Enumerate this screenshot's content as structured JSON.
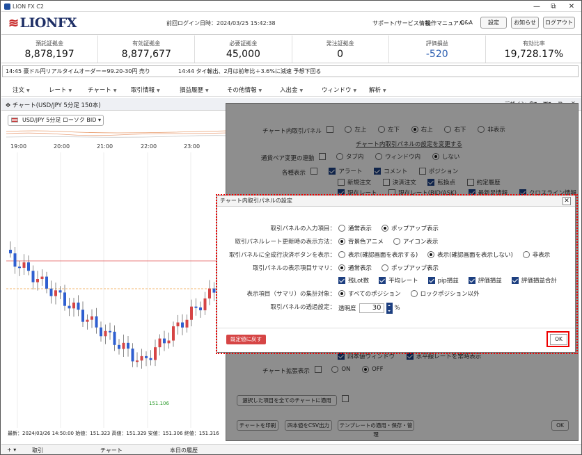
{
  "window": {
    "title": "LION FX C2",
    "controls": [
      "—",
      "⧉",
      "✕"
    ]
  },
  "header": {
    "logo": "LIONFX",
    "last_login": "前回ログイン日時：2024/03/25 15:42:38",
    "links": [
      "サポート/サービス情報",
      "操作マニュアル",
      "Q&A"
    ],
    "buttons": [
      "設定",
      "お知らせ",
      "ログアウト"
    ]
  },
  "summary": [
    {
      "label": "預託証拠金",
      "value": "8,878,197"
    },
    {
      "label": "有効証拠金",
      "value": "8,877,677"
    },
    {
      "label": "必要証拠金",
      "value": "45,000"
    },
    {
      "label": "発注証拠金",
      "value": "0"
    },
    {
      "label": "評価損益",
      "value": "-520"
    },
    {
      "label": "有効比率",
      "value": "19,728.17%"
    }
  ],
  "ticker": "14:45  豪ドル円リアルタイムオーダー＝99.20-30円  売り　　　　　14:44  タイ輸出、2月は前年比＋3.6%に減速  予想下回る",
  "menu": [
    "注文",
    "レート",
    "チャート",
    "取引情報",
    "損益履歴",
    "その他情報",
    "入出金",
    "ウィンドウ",
    "解析"
  ],
  "chart": {
    "title": "チャート(USD/JPY 5分足 150本)",
    "pair_select": "USD/JPY 5分足 ローソク BID",
    "time_labels": [
      "19:00",
      "20:00",
      "21:00",
      "22:00",
      "23:00"
    ],
    "low_label": "151.106",
    "info": "最新：2024/03/26 14:50:00  始値：151.323  高値：151.329  安値：151.306  終値：151.316",
    "design_label": "デザイン"
  },
  "bottom_tabs": [
    "取引",
    "チャート",
    "本日の履歴"
  ],
  "panel": {
    "trade_panel_label": "チャート内取引パネル",
    "trade_panel_options": [
      "左上",
      "左下",
      "右上",
      "右下",
      "非表示"
    ],
    "trade_panel_selected": 2,
    "trade_panel_link": "チャート内取引パネルの設定を変更する",
    "pair_change_label": "通貨ペア変更の連動",
    "pair_change_options": [
      "タブ内",
      "ウィンドウ内",
      "しない"
    ],
    "pair_change_selected": 2,
    "display_label": "各種表示",
    "display_items": [
      {
        "label": "アラート",
        "on": true
      },
      {
        "label": "コメント",
        "on": true
      },
      {
        "label": "ポジション",
        "on": false
      },
      {
        "label": "新規注文",
        "on": false
      },
      {
        "label": "決済注文",
        "on": false
      },
      {
        "label": "転換点",
        "on": true
      },
      {
        "label": "約定履歴",
        "on": false
      },
      {
        "label": "現在レート",
        "on": true
      },
      {
        "label": "現在レート(BID/ASK)",
        "on": false
      },
      {
        "label": "最新足情報",
        "on": true
      },
      {
        "label": "クロスライン情報",
        "on": true
      }
    ],
    "lower_row1": [
      "四本値ウィンドウ",
      "水平線レートを常時表示"
    ],
    "extend_label": "チャート拡張表示",
    "extend_options": [
      "ON",
      "OFF"
    ],
    "extend_selected": 1,
    "apply_all": "選択した項目を全てのチャートに適用",
    "print_btn": "チャートを印刷",
    "csv_btn": "四本値をCSV出力",
    "template_btn": "テンプレートの適用・保存・管理",
    "ok_btn": "OK"
  },
  "dialog": {
    "title": "チャート内取引パネルの設定",
    "rows": [
      {
        "label": "取引パネルの入力項目：",
        "options": [
          "通常表示",
          "ポップアップ表示"
        ],
        "selected": 1
      },
      {
        "label": "取引パネルレート更新時の表示方法：",
        "options": [
          "背景色アニメ",
          "アイコン表示"
        ],
        "selected": 0
      },
      {
        "label": "取引パネルに全成行決済ボタンを表示：",
        "options": [
          "表示(確認画面を表示する)",
          "表示(確認画面を表示しない)",
          "非表示"
        ],
        "selected": 1
      },
      {
        "label": "取引パネルの表示項目サマリ：",
        "options": [
          "通常表示",
          "ポップアップ表示"
        ],
        "selected": 0
      },
      {
        "label": "表示項目（サマリ）の集計対象：",
        "options": [
          "すべてのポジション",
          "ロックポジション以外"
        ],
        "selected": 0
      }
    ],
    "summary_checks": [
      {
        "label": "残Lot数",
        "on": true
      },
      {
        "label": "平均レート",
        "on": true
      },
      {
        "label": "pip損益",
        "on": true
      },
      {
        "label": "評価損益",
        "on": true
      },
      {
        "label": "評価損益合計",
        "on": true
      }
    ],
    "opacity_label": "取引パネルの透過設定：",
    "opacity_prefix": "透明度",
    "opacity_value": "30",
    "opacity_unit": "%",
    "reset_btn": "既定値に戻す",
    "ok_btn": "OK"
  },
  "colors": {
    "accent": "#1d3f80",
    "red": "#e00000",
    "up": "#d64545",
    "down": "#2f5fd0"
  }
}
